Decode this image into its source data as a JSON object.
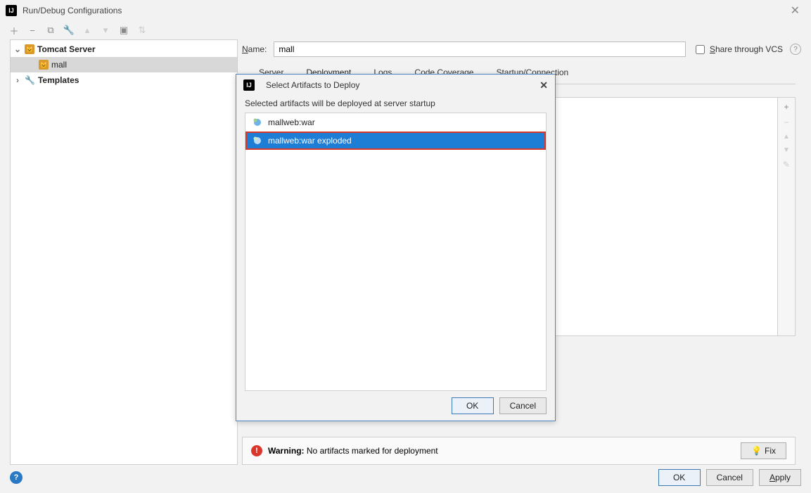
{
  "window": {
    "title": "Run/Debug Configurations"
  },
  "toolbar": {
    "icons": [
      "add",
      "remove",
      "copy",
      "wrench",
      "up",
      "down",
      "folder",
      "sort"
    ]
  },
  "tree": {
    "tomcat_label": "Tomcat Server",
    "mall_label": "mall",
    "templates_label": "Templates"
  },
  "name_row": {
    "label_prefix": "N",
    "label_rest": "ame:",
    "value": "mall",
    "share_prefix": "S",
    "share_rest": "hare through VCS"
  },
  "tabs": {
    "server": "Server",
    "deployment": "Deployment",
    "logs": "Logs",
    "coverage": "Code Coverage",
    "startup": "Startup/Connection"
  },
  "side_tools": {
    "add": "+",
    "remove": "−",
    "up": "▲",
    "down": "▼",
    "edit": "✎"
  },
  "warning": {
    "label": "Warning:",
    "text": "No artifacts marked for deployment",
    "fix": "Fix"
  },
  "bottom": {
    "ok": "OK",
    "cancel": "Cancel",
    "apply": "Apply"
  },
  "modal": {
    "title": "Select Artifacts to Deploy",
    "desc": "Selected artifacts will be deployed at server startup",
    "items": [
      {
        "label": "mallweb:war"
      },
      {
        "label": "mallweb:war exploded"
      }
    ],
    "ok": "OK",
    "cancel": "Cancel"
  }
}
